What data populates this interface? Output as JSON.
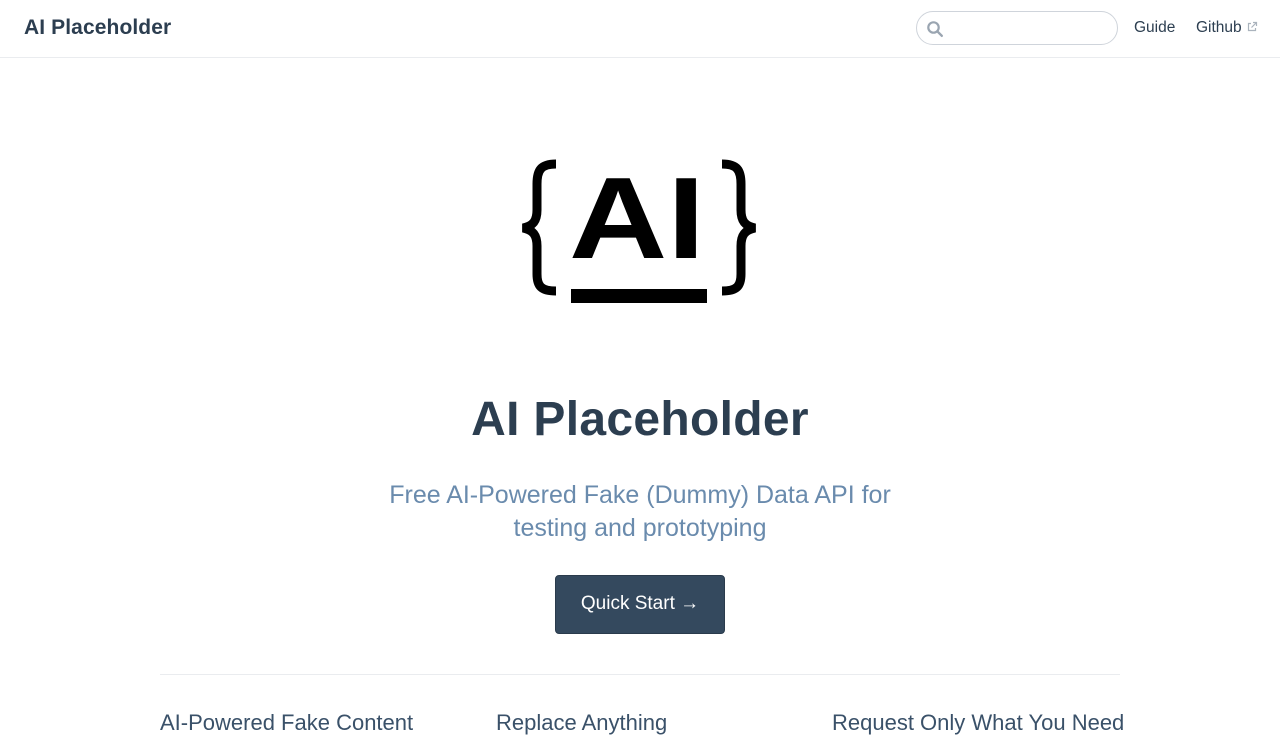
{
  "navbar": {
    "site_name": "AI Placeholder",
    "search": {
      "value": "",
      "placeholder": ""
    },
    "links": [
      {
        "label": "Guide",
        "external": false
      },
      {
        "label": "Github",
        "external": true
      }
    ]
  },
  "hero": {
    "logo_text": "AI",
    "title": "AI Placeholder",
    "description": "Free AI-Powered Fake (Dummy) Data API for testing and prototyping",
    "action_label": "Quick Start →"
  },
  "features": [
    {
      "title": "AI-Powered Fake Content"
    },
    {
      "title": "Replace Anything"
    },
    {
      "title": "Request Only What You Need"
    }
  ],
  "colors": {
    "text": "#2c3e50",
    "muted": "#6a8bad",
    "button_bg": "#34495e",
    "border": "#eaecef"
  },
  "icons": [
    "search-icon",
    "external-link-icon"
  ]
}
